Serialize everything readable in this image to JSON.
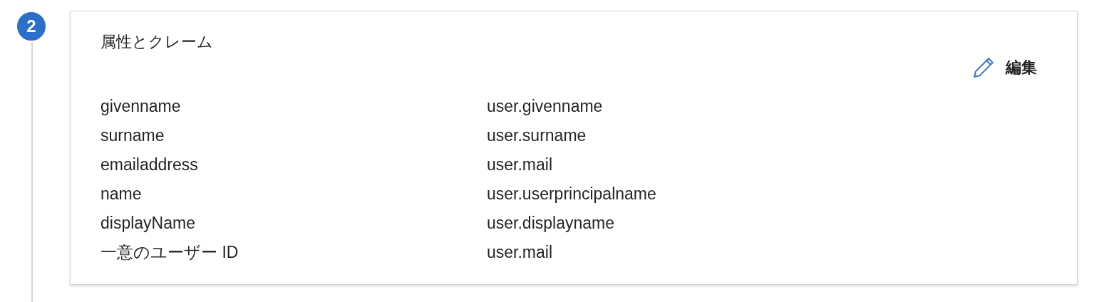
{
  "step": {
    "number": "2"
  },
  "card": {
    "title": "属性とクレーム",
    "edit_button": {
      "label": "編集"
    },
    "rows": [
      {
        "claim": "givenname",
        "value": "user.givenname"
      },
      {
        "claim": "surname",
        "value": "user.surname"
      },
      {
        "claim": "emailaddress",
        "value": "user.mail"
      },
      {
        "claim": "name",
        "value": "user.userprincipalname"
      },
      {
        "claim": "displayName",
        "value": "user.displayname"
      },
      {
        "claim": "一意のユーザー ID",
        "value": "user.mail"
      }
    ]
  }
}
